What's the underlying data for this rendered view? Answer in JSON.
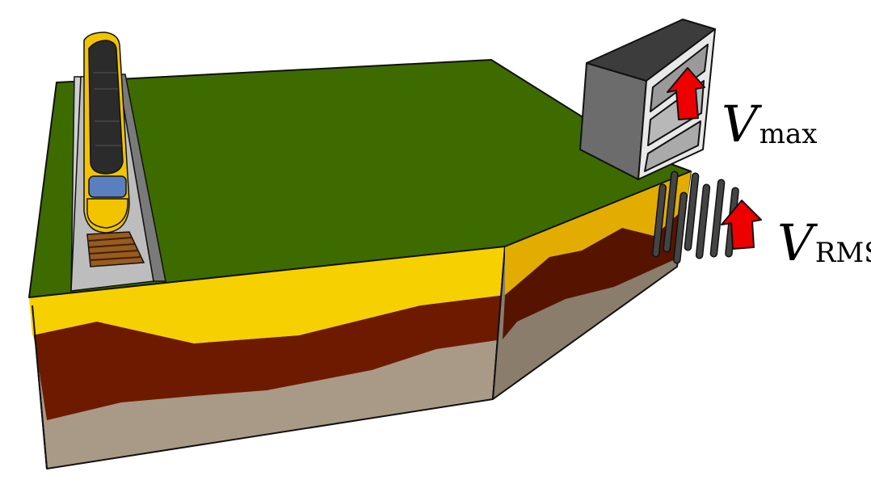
{
  "labels": {
    "vmax": {
      "symbol": "V",
      "subscript": "max"
    },
    "vrms": {
      "symbol": "V",
      "subscript": "RMS"
    }
  },
  "colors": {
    "grass": "#3d6b00",
    "sand": "#f7d000",
    "sand_side": "#e2ad00",
    "clay": "#6e1a00",
    "clay_side": "#561400",
    "base": "#a89a86",
    "base_side": "#8a7d6b",
    "building": "#6c6c6c",
    "train": "#f2c400",
    "arrow": "#ee0000"
  }
}
